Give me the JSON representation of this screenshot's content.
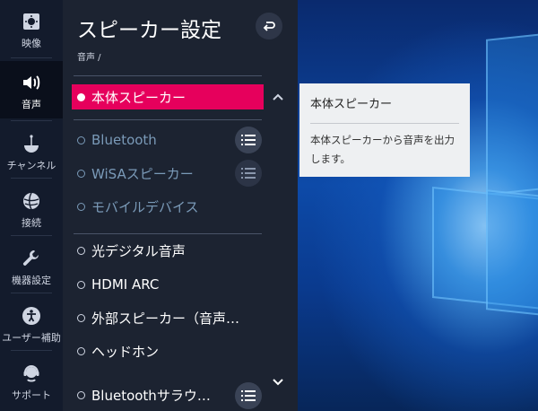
{
  "sidebar": {
    "items": [
      {
        "label": "映像",
        "icon": "picture-icon"
      },
      {
        "label": "音声",
        "icon": "speaker-icon"
      },
      {
        "label": "チャンネル",
        "icon": "satellite-dish-icon"
      },
      {
        "label": "接続",
        "icon": "globe-icon"
      },
      {
        "label": "機器設定",
        "icon": "wrench-icon"
      },
      {
        "label": "ユーザー補助",
        "icon": "accessibility-icon"
      },
      {
        "label": "サポート",
        "icon": "support-headset-icon"
      }
    ],
    "active_index": 1
  },
  "panel": {
    "title": "スピーカー設定",
    "breadcrumb": "音声 /",
    "options_group1": [
      {
        "label": "本体スピーカー",
        "selected": true
      },
      {
        "label": "Bluetooth",
        "dim": true,
        "has_list_button": true
      },
      {
        "label": "WiSAスピーカー",
        "dim": true,
        "has_list_button": true
      },
      {
        "label": "モバイルデバイス",
        "dim": true
      }
    ],
    "options_group2": [
      {
        "label": "光デジタル音声"
      },
      {
        "label": "HDMI ARC"
      },
      {
        "label": "外部スピーカー（音声…"
      },
      {
        "label": "ヘッドホン"
      },
      {
        "label": "Bluetoothサラウ…",
        "has_list_button": true
      }
    ]
  },
  "tooltip": {
    "title": "本体スピーカー",
    "body": "本体スピーカーから音声を出力します。"
  },
  "colors": {
    "selection": "#e6005c",
    "panel_bg": "#1c2331",
    "sidebar_bg": "#131b2c"
  }
}
